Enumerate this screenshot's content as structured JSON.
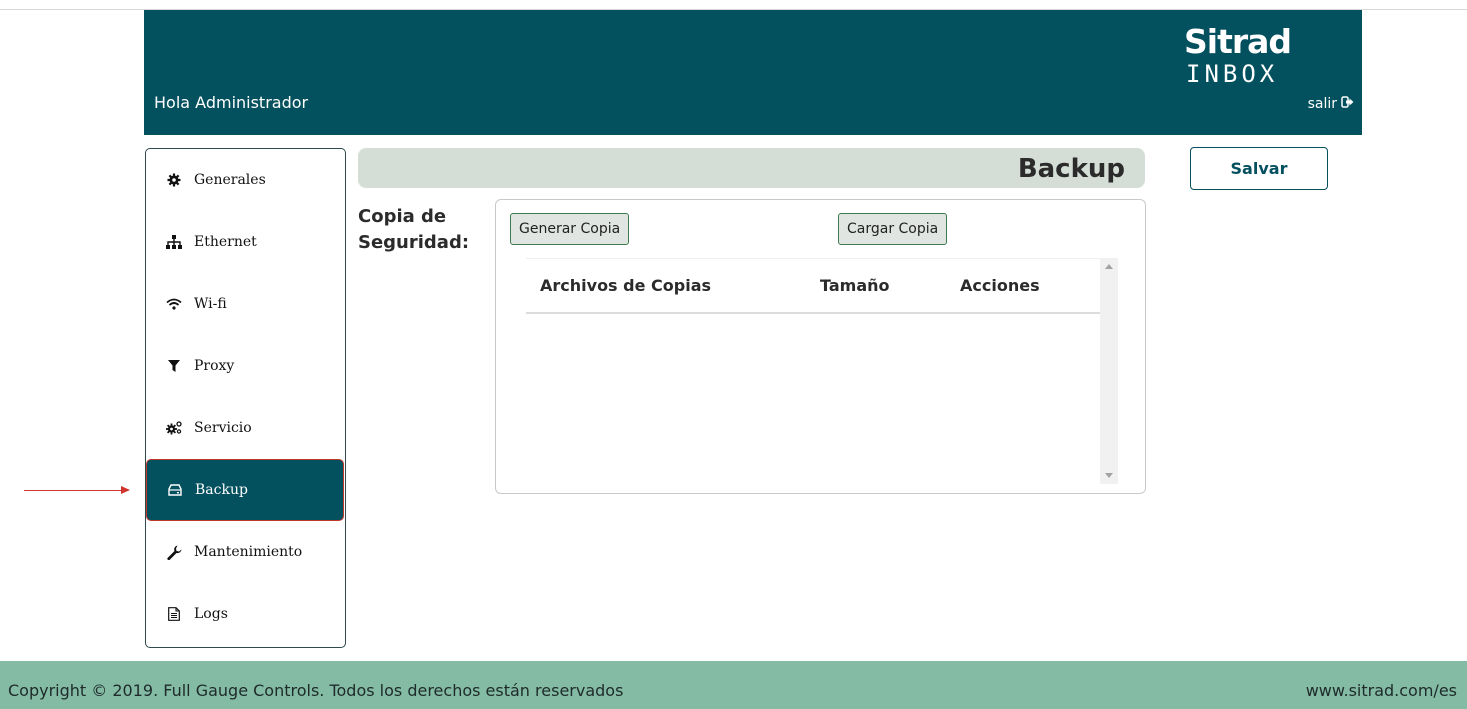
{
  "header": {
    "greeting": "Hola Administrador",
    "logo_brand": "Sitrad",
    "logo_sub": "INBOX",
    "logout_label": "salir"
  },
  "sidebar": {
    "items": [
      {
        "label": "Generales",
        "icon": "gear-icon"
      },
      {
        "label": "Ethernet",
        "icon": "sitemap-icon"
      },
      {
        "label": "Wi-fi",
        "icon": "wifi-icon"
      },
      {
        "label": "Proxy",
        "icon": "filter-icon"
      },
      {
        "label": "Servicio",
        "icon": "cogs-icon"
      },
      {
        "label": "Backup",
        "icon": "hdd-icon",
        "active": true
      },
      {
        "label": "Mantenimiento",
        "icon": "wrench-icon"
      },
      {
        "label": "Logs",
        "icon": "file-text-icon"
      }
    ]
  },
  "main": {
    "title": "Backup",
    "save_label": "Salvar",
    "section_label_line1": "Copia de",
    "section_label_line2": "Seguridad:",
    "generate_label": "Generar Copia",
    "load_label": "Cargar Copia",
    "table": {
      "columns": [
        "Archivos de Copias",
        "Tamaño",
        "Acciones"
      ],
      "rows": []
    }
  },
  "footer": {
    "copyright": "Copyright © 2019.  Full Gauge Controls.   Todos los derechos están reservados",
    "site": "www.sitrad.com/es"
  },
  "colors": {
    "header_bg": "#03505e",
    "footer_bg": "#83bba5",
    "title_bar_bg": "#d4ddd6",
    "annotation_arrow": "#d0342c"
  }
}
